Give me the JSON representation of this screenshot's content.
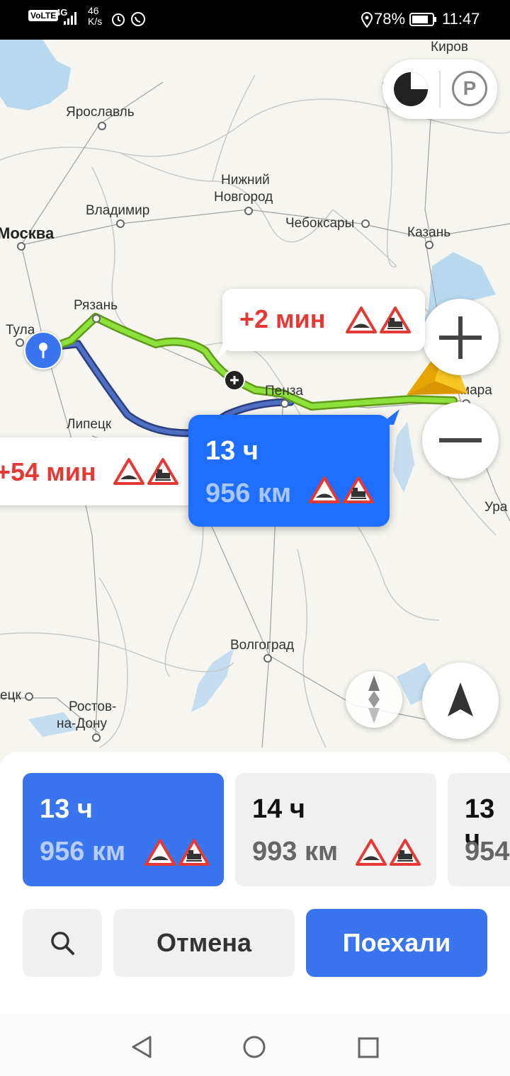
{
  "status": {
    "network": "4G",
    "speed_value": "46",
    "speed_unit": "K/s",
    "battery": "78%",
    "time": "11:47"
  },
  "map": {
    "cities": {
      "kirov": "Киров",
      "yaroslavl": "Ярославль",
      "nizhny": "Нижний",
      "nizhny2": "Новгород",
      "vladimir": "Владимир",
      "cheboksary": "Чебоксары",
      "kazan": "Казань",
      "moscow": "Москва",
      "ryazan": "Рязань",
      "tula": "Тула",
      "penza": "Пенза",
      "samara": "мара",
      "lipetsk": "Липецк",
      "ura": "Ура",
      "volgograd": "Волгоград",
      "donetsk": "ецк",
      "rostov1": "Ростов-",
      "rostov2": "на-Дону"
    },
    "callouts": {
      "alt1_delta": "+2 мин",
      "alt2_delta": "+54 мин",
      "main_time": "13 ч",
      "main_dist": "956 км"
    },
    "icons": {
      "layers": "layers-icon",
      "parking": "parking-icon",
      "parking_letter": "P",
      "zoom_in": "plus-icon",
      "zoom_out": "minus-icon",
      "compass": "compass-icon",
      "locate": "navigation-arrow-icon"
    },
    "route_colors": {
      "selected": "#7ed321",
      "alternative": "#3f5ea8"
    }
  },
  "routes": [
    {
      "time": "13 ч",
      "dist": "956 км",
      "selected": true
    },
    {
      "time": "14 ч",
      "dist": "993 км",
      "selected": false
    },
    {
      "time": "13 ч",
      "dist": "954",
      "selected": false
    }
  ],
  "actions": {
    "cancel": "Отмена",
    "go": "Поехали"
  },
  "colors": {
    "accent": "#3a75f0",
    "warning_red": "#e53935"
  }
}
